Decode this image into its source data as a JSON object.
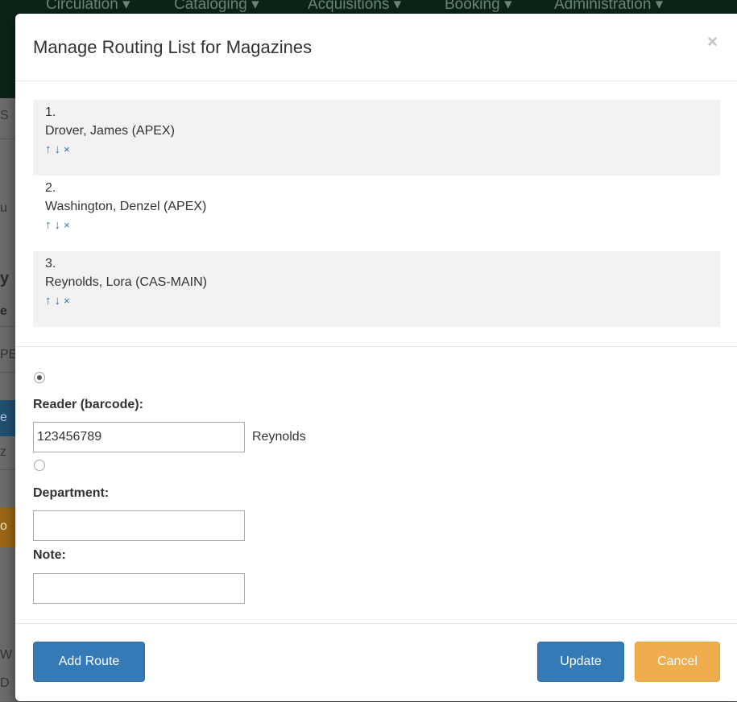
{
  "background": {
    "nav_items": [
      "Circulation ▾",
      "Cataloging ▾",
      "Acquisitions ▾",
      "Booking ▾",
      "Administration ▾"
    ],
    "fragments": [
      "S",
      "u",
      "y",
      "e",
      "PE",
      "e",
      "z",
      "o",
      "W",
      "D"
    ]
  },
  "modal": {
    "title": "Manage Routing List for Magazines",
    "close": "×"
  },
  "routes": [
    {
      "number": "1.",
      "name": "Drover, James (APEX)"
    },
    {
      "number": "2.",
      "name": "Washington, Denzel (APEX)"
    },
    {
      "number": "3.",
      "name": "Reynolds, Lora (CAS-MAIN)"
    }
  ],
  "route_actions": {
    "up": "↑",
    "down": "↓",
    "remove": "×"
  },
  "form": {
    "reader_label": "Reader (barcode):",
    "reader_value": "123456789",
    "reader_name": "Reynolds",
    "reader_selected": true,
    "department_label": "Department:",
    "department_value": "",
    "department_selected": false,
    "note_label": "Note:",
    "note_value": ""
  },
  "footer": {
    "add_route_label": "Add Route",
    "update_label": "Update",
    "cancel_label": "Cancel"
  },
  "colors": {
    "primary": "#337ab7",
    "warning": "#f0ad4e",
    "link": "#2f6eb5",
    "navbar": "#0b2417"
  }
}
